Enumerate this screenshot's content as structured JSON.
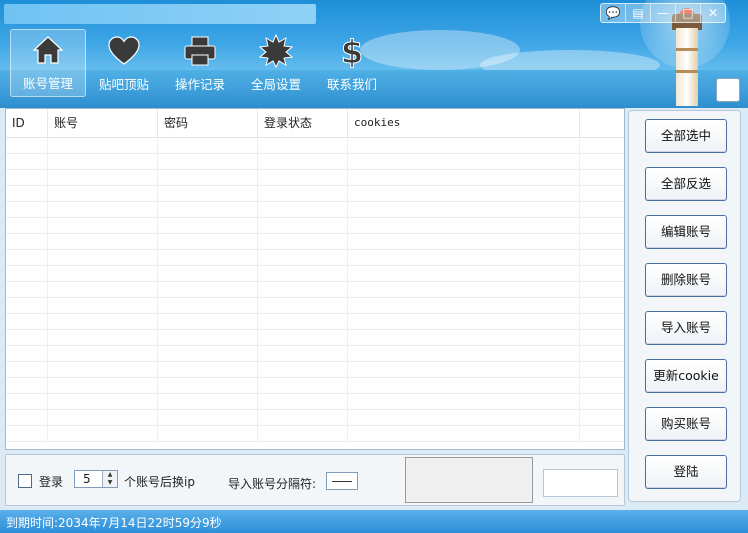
{
  "window": {
    "controls": [
      "message-icon",
      "skin-icon",
      "minimize-icon",
      "maximize-icon",
      "close-icon"
    ],
    "control_glyphs": [
      "💬",
      "▤",
      "—",
      "□",
      "✕"
    ]
  },
  "nav": [
    {
      "label": "账号管理",
      "icon": "home-icon",
      "active": true
    },
    {
      "label": "贴吧顶贴",
      "icon": "heart-icon",
      "active": false
    },
    {
      "label": "操作记录",
      "icon": "printer-icon",
      "active": false
    },
    {
      "label": "全局设置",
      "icon": "gear-icon",
      "active": false
    },
    {
      "label": "联系我们",
      "icon": "dollar-icon",
      "active": false
    }
  ],
  "table": {
    "columns": [
      "ID",
      "账号",
      "密码",
      "登录状态",
      "cookies"
    ],
    "rows": []
  },
  "bottom": {
    "login_label": "登录",
    "login_checked": false,
    "switch_count": "5",
    "switch_label": "个账号后换ip",
    "separator_label": "导入账号分隔符:",
    "separator_value": "——"
  },
  "buttons": {
    "select_all": "全部选中",
    "invert_select": "全部反选",
    "edit_account": "编辑账号",
    "delete_account": "删除账号",
    "import_account": "导入账号",
    "update_cookie": "更新cookie",
    "buy_account": "购买账号",
    "login": "登陆"
  },
  "status": {
    "expiry": "到期时间:2034年7月14日22时59分9秒"
  },
  "colors": {
    "header_top": "#1e8fd8",
    "header_bottom": "#9fd6f4",
    "button_border": "#4d6fa0",
    "status_bar": "#2d8fd8"
  }
}
